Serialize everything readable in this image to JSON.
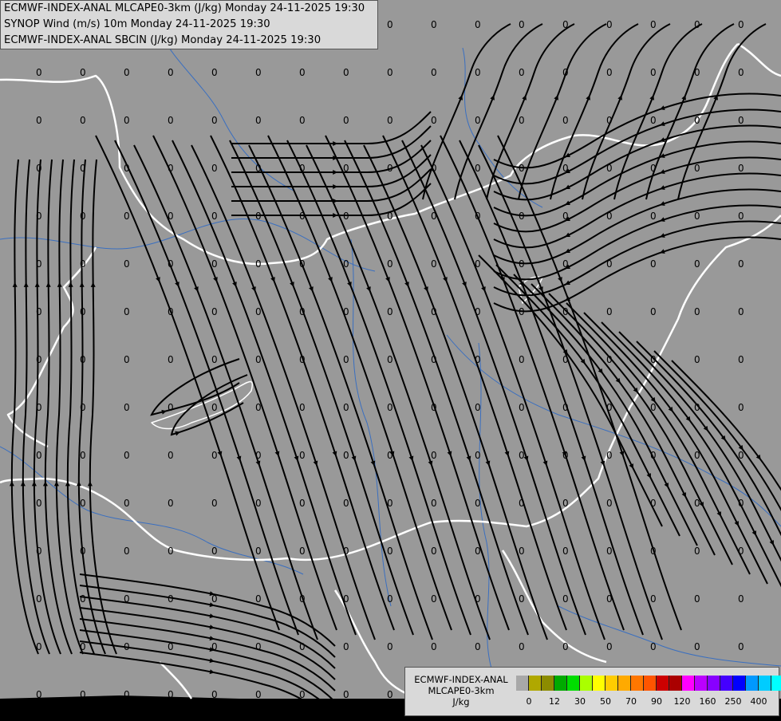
{
  "header": {
    "line1": "ECMWF-INDEX-ANAL MLCAPE0-3km (J/kg) Monday 24-11-2025 19:30",
    "line2": "SYNOP Wind (m/s) 10m Monday 24-11-2025 19:30",
    "line3": "ECMWF-INDEX-ANAL SBCIN (J/kg) Monday 24-11-2025 19:30"
  },
  "map": {
    "background_color": "#999999",
    "station_value": "0",
    "border_color": "#ffffff",
    "river_color": "#3a6fc0",
    "streamline_color": "#000000"
  },
  "legend": {
    "title_line1": "ECMWF-INDEX-ANAL",
    "title_line2": "MLCAPE0-3km",
    "title_line3": "J/kg",
    "colors": [
      "#a8a8a8",
      "#b0a800",
      "#8c8c00",
      "#00aa00",
      "#00dd00",
      "#aaff00",
      "#ffff00",
      "#ffcc00",
      "#ffaa00",
      "#ff7700",
      "#ff5500",
      "#cc0000",
      "#aa0000",
      "#ff00ff",
      "#bb00ff",
      "#8800ff",
      "#4400ff",
      "#0000ff",
      "#0099ff",
      "#00ccff",
      "#00ffff",
      "#88ffff",
      "#ffffff"
    ],
    "ticks": [
      "0",
      "12",
      "30",
      "50",
      "70",
      "90",
      "120",
      "160",
      "250",
      "400"
    ]
  }
}
